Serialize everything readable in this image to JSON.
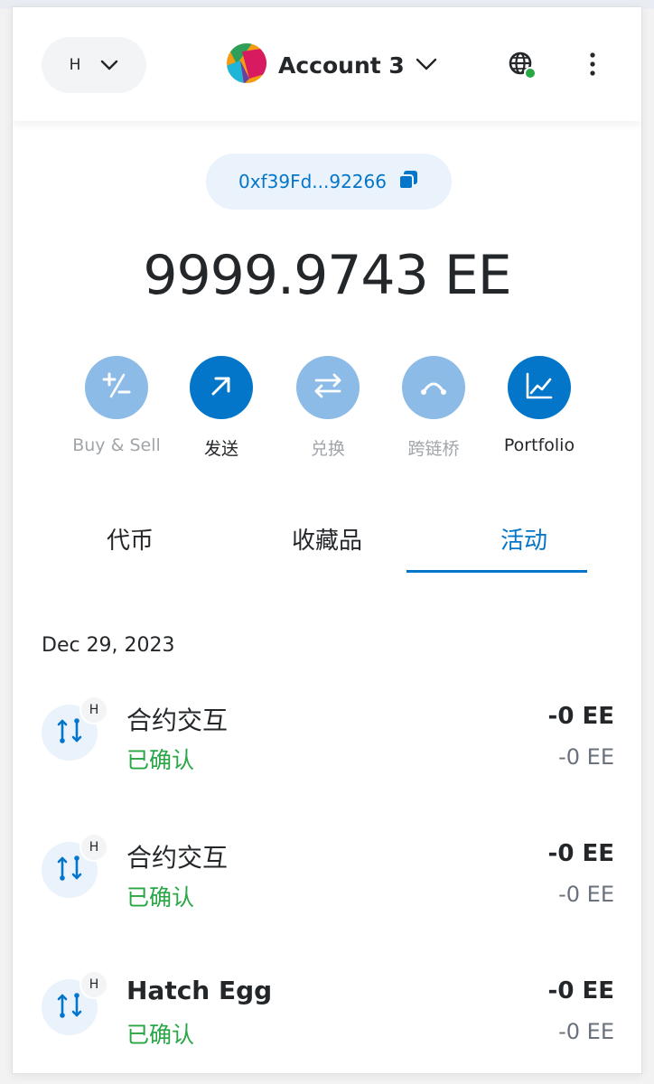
{
  "header": {
    "network_label": "H",
    "account_name": "Account 3"
  },
  "address": {
    "short": "0xf39Fd...92266"
  },
  "balance": {
    "amount": "9999.9743",
    "unit": "EE"
  },
  "actions": [
    {
      "label": "Buy & Sell",
      "icon": "plus-minus-icon",
      "enabled": false
    },
    {
      "label": "发送",
      "icon": "arrow-up-right-icon",
      "enabled": true
    },
    {
      "label": "兑换",
      "icon": "swap-arrows-icon",
      "enabled": false
    },
    {
      "label": "跨链桥",
      "icon": "bridge-icon",
      "enabled": false
    },
    {
      "label": "Portfolio",
      "icon": "chart-icon",
      "enabled": true
    }
  ],
  "tabs": [
    {
      "label": "代币",
      "active": false
    },
    {
      "label": "收藏品",
      "active": false
    },
    {
      "label": "活动",
      "active": true
    }
  ],
  "activity": {
    "date": "Dec 29, 2023",
    "items": [
      {
        "title": "合约交互",
        "status": "已确认",
        "amount": "-0 EE",
        "secondary": "-0 EE",
        "badge": "H"
      },
      {
        "title": "合约交互",
        "status": "已确认",
        "amount": "-0 EE",
        "secondary": "-0 EE",
        "badge": "H"
      },
      {
        "title": "Hatch Egg",
        "status": "已确认",
        "amount": "-0 EE",
        "secondary": "-0 EE",
        "badge": "H"
      }
    ]
  },
  "colors": {
    "accent": "#0376c9",
    "accent_disabled": "#8bbbe6",
    "success": "#28a745",
    "text": "#24272a"
  }
}
